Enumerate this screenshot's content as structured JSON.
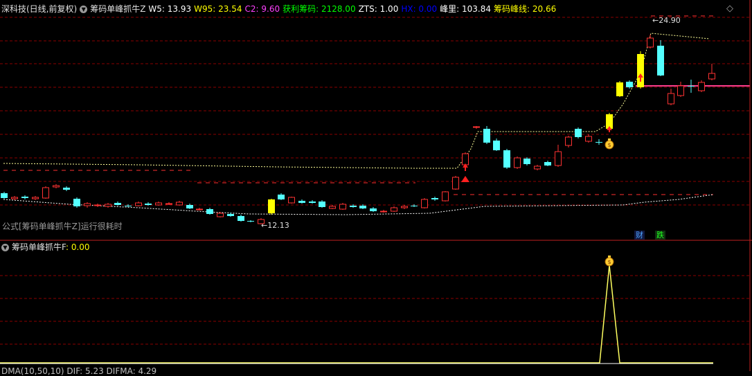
{
  "main_panel": {
    "stock_name": "深科技(日线,前复权)",
    "indicator_name": "筹码单峰抓牛Z",
    "fields": [
      {
        "label": "W5:",
        "value": "13.93",
        "color": "#ffffff"
      },
      {
        "label": "W95:",
        "value": "23.54",
        "color": "#ffff00"
      },
      {
        "label": "C2:",
        "value": "9.60",
        "color": "#ff40ff"
      },
      {
        "label": "获利筹码:",
        "value": "2128.00",
        "color": "#00ff00"
      },
      {
        "label": "ZTS:",
        "value": "1.00",
        "color": "#ffffff"
      },
      {
        "label": "HX:",
        "value": "0.00",
        "color": "#0000ff"
      },
      {
        "label": "峰里:",
        "value": "103.84",
        "color": "#ffffff"
      },
      {
        "label": "筹码峰线:",
        "value": "20.66",
        "color": "#ffff00"
      }
    ],
    "high_label": "24.90",
    "low_label": "12.13",
    "status_text": "公式[筹码单峰抓牛Z]运行很耗时",
    "badge_finance": "财",
    "badge_drop": "跌",
    "settings_icon": "diamond-icon"
  },
  "sub_panel": {
    "indicator_name": "筹码单峰抓牛F",
    "value_label": ": 0.00",
    "signal_icon": "money-bag-icon"
  },
  "bottom_panel": {
    "text": "DMA(10,50,10) DIF: 5.23 DIFMA: 4.29"
  },
  "colors": {
    "up": "#ff3232",
    "down": "#54ffff",
    "yellow_candle": "#ffff00",
    "grid": "#8b0000",
    "dotted_line": "#ffff99",
    "support_line": "#ff3c8c"
  }
}
